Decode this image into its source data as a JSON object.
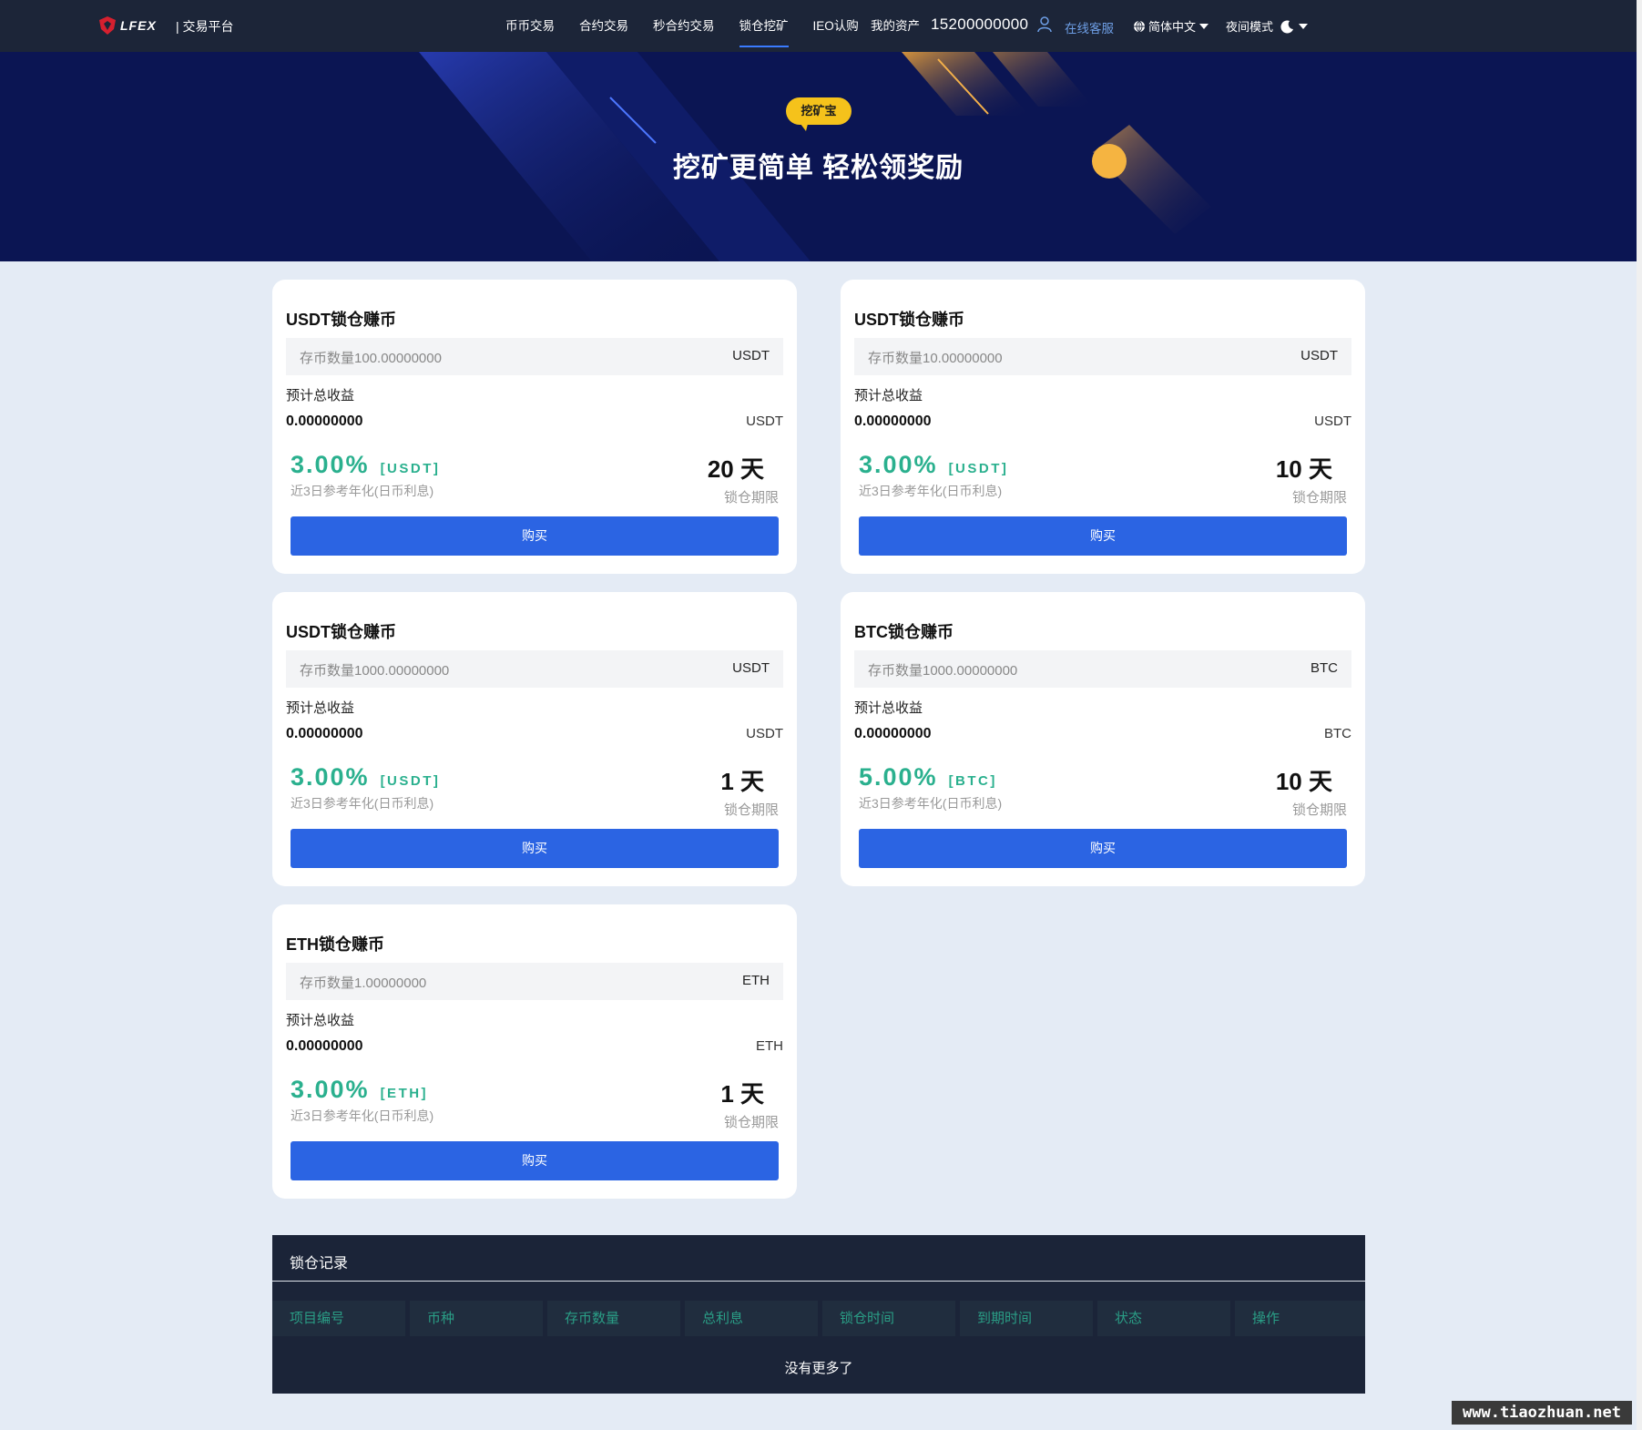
{
  "header": {
    "logo_text": "LFEX",
    "platform": "| 交易平台",
    "nav": [
      {
        "label": "币币交易",
        "active": false
      },
      {
        "label": "合约交易",
        "active": false
      },
      {
        "label": "秒合约交易",
        "active": false
      },
      {
        "label": "锁仓挖矿",
        "active": true
      },
      {
        "label": "IEO认购",
        "active": false
      }
    ],
    "assets_label": "我的资产",
    "account": "15200000000",
    "service": "在线客服",
    "language": "简体中文",
    "night_mode": "夜间模式"
  },
  "banner": {
    "badge": "挖矿宝",
    "title": "挖矿更简单 轻松领奖励"
  },
  "products": [
    {
      "title": "USDT锁仓赚币",
      "deposit_placeholder": "存币数量100.00000000",
      "currency": "USDT",
      "earnings_label": "预计总收益",
      "earnings": "0.00000000",
      "rate": "3.00%",
      "rate_currency": "[USDT]",
      "rate_note": "近3日参考年化(日币利息)",
      "days": "20 天",
      "lock_label": "锁仓期限",
      "buy_label": "购买"
    },
    {
      "title": "USDT锁仓赚币",
      "deposit_placeholder": "存币数量10.00000000",
      "currency": "USDT",
      "earnings_label": "预计总收益",
      "earnings": "0.00000000",
      "rate": "3.00%",
      "rate_currency": "[USDT]",
      "rate_note": "近3日参考年化(日币利息)",
      "days": "10 天",
      "lock_label": "锁仓期限",
      "buy_label": "购买"
    },
    {
      "title": "USDT锁仓赚币",
      "deposit_placeholder": "存币数量1000.00000000",
      "currency": "USDT",
      "earnings_label": "预计总收益",
      "earnings": "0.00000000",
      "rate": "3.00%",
      "rate_currency": "[USDT]",
      "rate_note": "近3日参考年化(日币利息)",
      "days": "1 天",
      "lock_label": "锁仓期限",
      "buy_label": "购买"
    },
    {
      "title": "BTC锁仓赚币",
      "deposit_placeholder": "存币数量1000.00000000",
      "currency": "BTC",
      "earnings_label": "预计总收益",
      "earnings": "0.00000000",
      "rate": "5.00%",
      "rate_currency": "[BTC]",
      "rate_note": "近3日参考年化(日币利息)",
      "days": "10 天",
      "lock_label": "锁仓期限",
      "buy_label": "购买"
    },
    {
      "title": "ETH锁仓赚币",
      "deposit_placeholder": "存币数量1.00000000",
      "currency": "ETH",
      "earnings_label": "预计总收益",
      "earnings": "0.00000000",
      "rate": "3.00%",
      "rate_currency": "[ETH]",
      "rate_note": "近3日参考年化(日币利息)",
      "days": "1 天",
      "lock_label": "锁仓期限",
      "buy_label": "购买"
    }
  ],
  "records": {
    "title": "锁仓记录",
    "columns": [
      "项目编号",
      "币种",
      "存币数量",
      "总利息",
      "锁仓时间",
      "到期时间",
      "状态",
      "操作"
    ],
    "empty": "没有更多了"
  },
  "watermark": "www.tiaozhuan.net",
  "colors": {
    "nav_bg": "#1c2538",
    "banner_bg": "#0b1553",
    "accent_green": "#2ab08e",
    "button_blue": "#2b64e3",
    "badge_yellow": "#f5c21b",
    "page_bg": "#e4ebf5"
  }
}
